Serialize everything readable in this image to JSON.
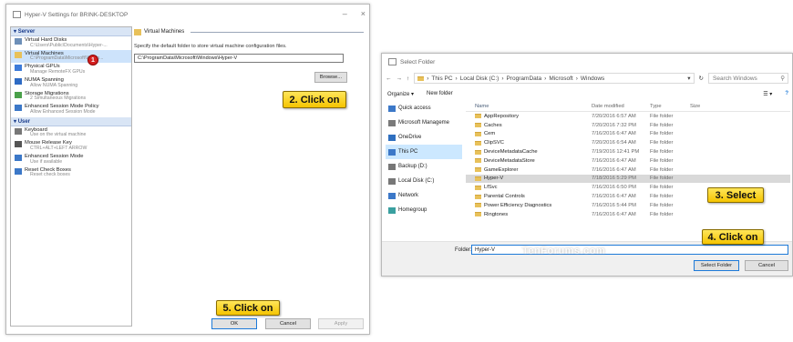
{
  "hyperv_window": {
    "title": "Hyper-V Settings for BRINK-DESKTOP",
    "tree": {
      "server_section": "Server",
      "user_section": "User",
      "server_items": [
        {
          "label": "Virtual Hard Disks",
          "sub": "C:\\Users\\Public\\Documents\\Hyper-...",
          "icon": "hard-disk-icon",
          "color": "#6d8fb8"
        },
        {
          "label": "Virtual Machines",
          "sub": "C:\\ProgramData\\Microsoft\\Windo...",
          "icon": "folder-icon",
          "color": "#e8c15a",
          "selected": true
        },
        {
          "label": "Physical GPUs",
          "sub": "Manage RemoteFX GPUs",
          "icon": "gpu-icon",
          "color": "#3d7bd9"
        },
        {
          "label": "NUMA Spanning",
          "sub": "Allow NUMA Spanning",
          "icon": "numa-icon",
          "color": "#2e6bc4"
        },
        {
          "label": "Storage Migrations",
          "sub": "2 Simultaneous Migrations",
          "icon": "storage-migration-icon",
          "color": "#4aa04a"
        },
        {
          "label": "Enhanced Session Mode Policy",
          "sub": "Allow Enhanced Session Mode",
          "icon": "session-policy-icon",
          "color": "#3c78c8"
        }
      ],
      "user_items": [
        {
          "label": "Keyboard",
          "sub": "Use on the virtual machine",
          "icon": "keyboard-icon",
          "color": "#777777"
        },
        {
          "label": "Mouse Release Key",
          "sub": "CTRL+ALT+LEFT ARROW",
          "icon": "mouse-icon",
          "color": "#555555"
        },
        {
          "label": "Enhanced Session Mode",
          "sub": "Use if available",
          "icon": "session-mode-icon",
          "color": "#3c78c8"
        },
        {
          "label": "Reset Check Boxes",
          "sub": "Reset check boxes",
          "icon": "reset-checkbox-icon",
          "color": "#3c78c8"
        }
      ]
    },
    "panel": {
      "title": "Virtual Machines",
      "description": "Specify the default folder to store virtual machine configuration files.",
      "path_value": "C:\\ProgramData\\Microsoft\\Windows\\Hyper-V",
      "browse_label": "Browse..."
    },
    "buttons": {
      "ok": "OK",
      "cancel": "Cancel",
      "apply": "Apply"
    }
  },
  "select_folder_window": {
    "title": "Select Folder",
    "breadcrumb": [
      "This PC",
      "Local Disk (C:)",
      "ProgramData",
      "Microsoft",
      "Windows"
    ],
    "search_placeholder": "Search Windows",
    "organize_label": "Organize",
    "new_folder_label": "New folder",
    "nav_items": [
      {
        "label": "Quick access",
        "icon": "star-icon",
        "color": "#3c78c8"
      },
      {
        "label": "Microsoft Manageme",
        "icon": "management-icon",
        "color": "#7a7a7a"
      },
      {
        "label": "OneDrive",
        "icon": "cloud-icon",
        "color": "#2f6fbf"
      },
      {
        "label": "This PC",
        "icon": "computer-icon",
        "color": "#3c78c8",
        "selected": true
      },
      {
        "label": "Backup (D:)",
        "icon": "drive-icon",
        "color": "#777777"
      },
      {
        "label": "Local Disk (C:)",
        "icon": "drive-icon",
        "color": "#777777"
      },
      {
        "label": "Network",
        "icon": "network-icon",
        "color": "#3c78c8"
      },
      {
        "label": "Homegroup",
        "icon": "homegroup-icon",
        "color": "#3aa0a0"
      }
    ],
    "columns": [
      "Name",
      "Date modified",
      "Type",
      "Size"
    ],
    "files": [
      {
        "name": "AppRepository",
        "date": "7/20/2016 6:57 AM",
        "type": "File folder"
      },
      {
        "name": "Caches",
        "date": "7/20/2016 7:32 PM",
        "type": "File folder"
      },
      {
        "name": "Cem",
        "date": "7/16/2016 6:47 AM",
        "type": "File folder"
      },
      {
        "name": "ClipSVC",
        "date": "7/20/2016 6:54 AM",
        "type": "File folder"
      },
      {
        "name": "DeviceMetadataCache",
        "date": "7/19/2016 12:41 PM",
        "type": "File folder"
      },
      {
        "name": "DeviceMetadataStore",
        "date": "7/16/2016 6:47 AM",
        "type": "File folder"
      },
      {
        "name": "GameExplorer",
        "date": "7/16/2016 6:47 AM",
        "type": "File folder"
      },
      {
        "name": "Hyper-V",
        "date": "7/18/2016 5:29 PM",
        "type": "File folder",
        "selected": true
      },
      {
        "name": "LfSvc",
        "date": "7/16/2016 6:50 PM",
        "type": "File folder"
      },
      {
        "name": "Parental Controls",
        "date": "7/16/2016 6:47 AM",
        "type": "File folder"
      },
      {
        "name": "Power Efficiency Diagnostics",
        "date": "7/16/2016 5:44 PM",
        "type": "File folder"
      },
      {
        "name": "Ringtones",
        "date": "7/16/2016 6:47 AM",
        "type": "File folder"
      }
    ],
    "folder_label": "Folder:",
    "folder_value": "Hyper-V",
    "select_folder_button": "Select Folder",
    "cancel_button": "Cancel",
    "watermark": "TenForums.com"
  },
  "callouts": {
    "step1": "1",
    "step2": "2. Click on",
    "step3": "3. Select",
    "step4": "4. Click on",
    "step5": "5. Click on"
  },
  "colors": {
    "callout": "#f5c400",
    "accent": "#1e7ad8",
    "badge": "#d42020"
  }
}
